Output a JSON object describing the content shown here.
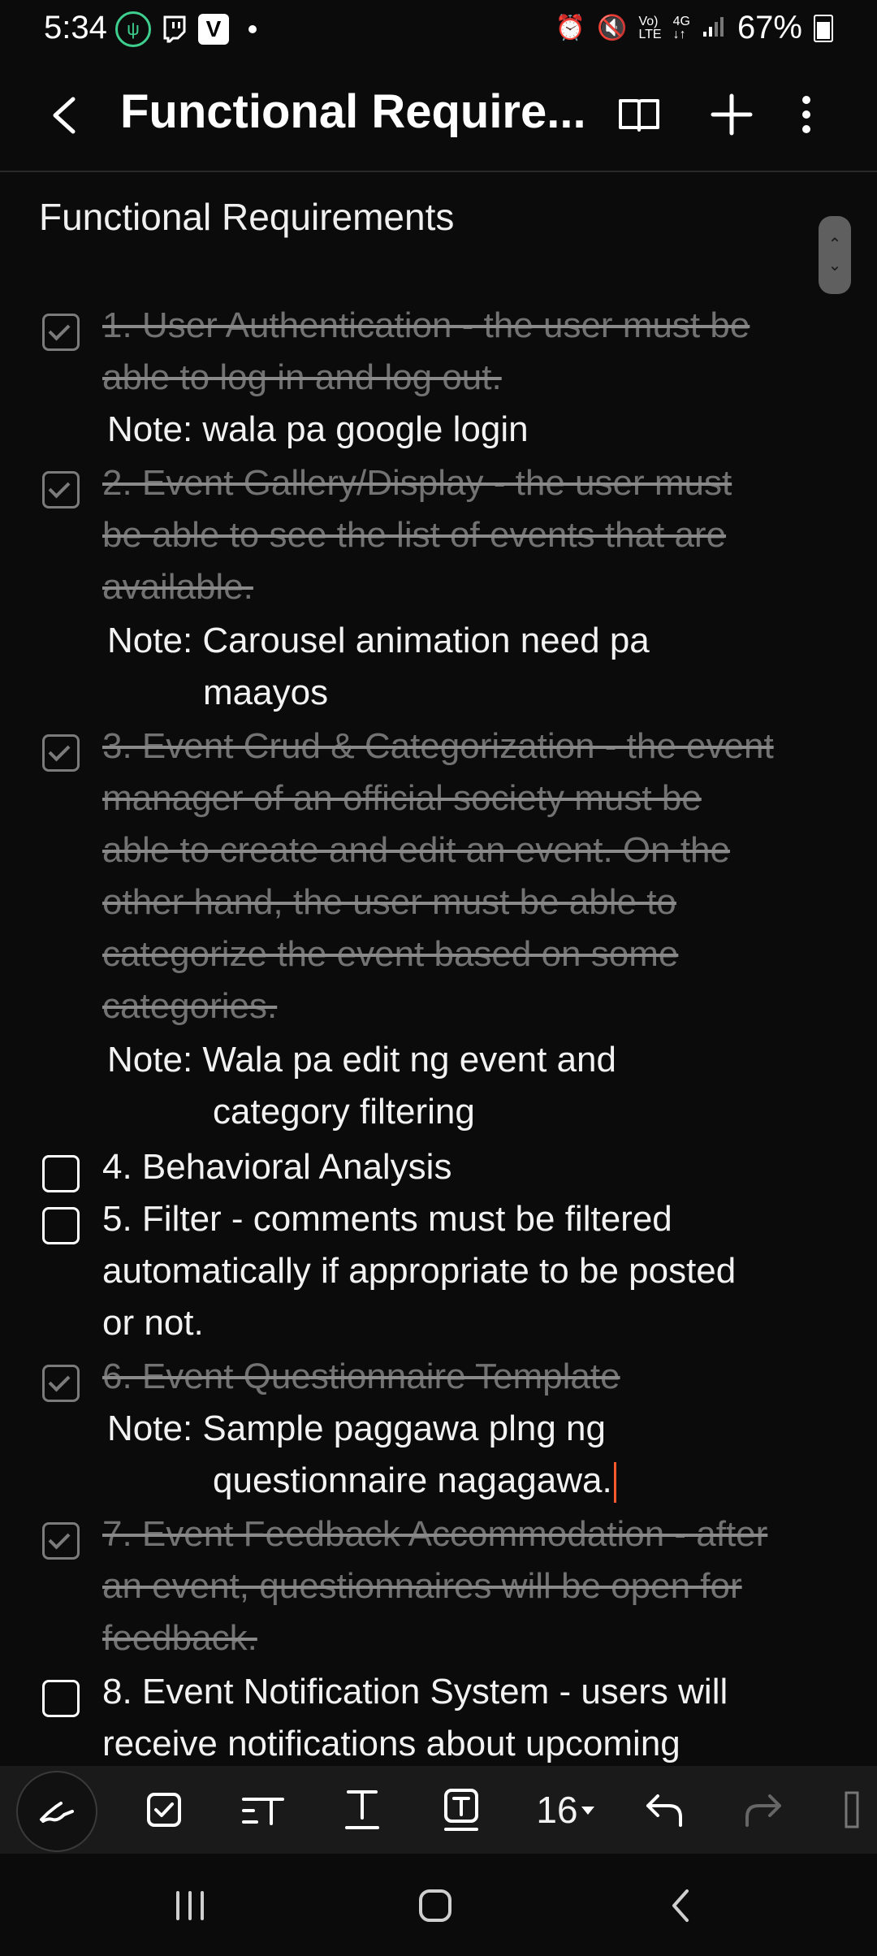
{
  "status_bar": {
    "time": "5:34",
    "battery": "67%"
  },
  "header": {
    "title": "Functional Require..."
  },
  "document": {
    "title": "Functional Requirements",
    "items": [
      {
        "checked": true,
        "lines": [
          "1. User Authentication - the user must be",
          "able to log in and log out."
        ],
        "note": [
          "Note: wala pa google login"
        ]
      },
      {
        "checked": true,
        "lines": [
          "2. Event Gallery/Display - the user must",
          "be able to see the list of events that are",
          "available."
        ],
        "note": [
          "Note: Carousel animation need pa",
          "maayos"
        ]
      },
      {
        "checked": true,
        "lines": [
          "3. Event Crud & Categorization - the event",
          "manager of an official society must be",
          "able to create and edit an event. On the",
          "other hand, the user must be able to",
          "categorize the event based on some",
          "categories."
        ],
        "note": [
          "Note: Wala pa edit ng event and",
          "category filtering"
        ]
      },
      {
        "checked": false,
        "lines": [
          "4. Behavioral Analysis"
        ]
      },
      {
        "checked": false,
        "lines": [
          "5. Filter - comments must be filtered",
          "automatically if appropriate to be posted",
          "or not."
        ]
      },
      {
        "checked": true,
        "lines": [
          "6. Event Questionnaire Template"
        ],
        "note": [
          "Note: Sample paggawa plng ng",
          "questionnaire nagagawa."
        ]
      },
      {
        "checked": true,
        "lines": [
          "7. Event Feedback Accommodation - after",
          "an event, questionnaires will be open for",
          "feedback."
        ]
      },
      {
        "checked": false,
        "lines": [
          "8. Event Notification System - users will",
          "receive notifications about upcoming"
        ]
      }
    ]
  },
  "toolbar": {
    "font_size": "16"
  },
  "colors": {
    "caret": "#ff5a2e",
    "checked": "#7b7b7b",
    "background": "#0b0b0b"
  }
}
